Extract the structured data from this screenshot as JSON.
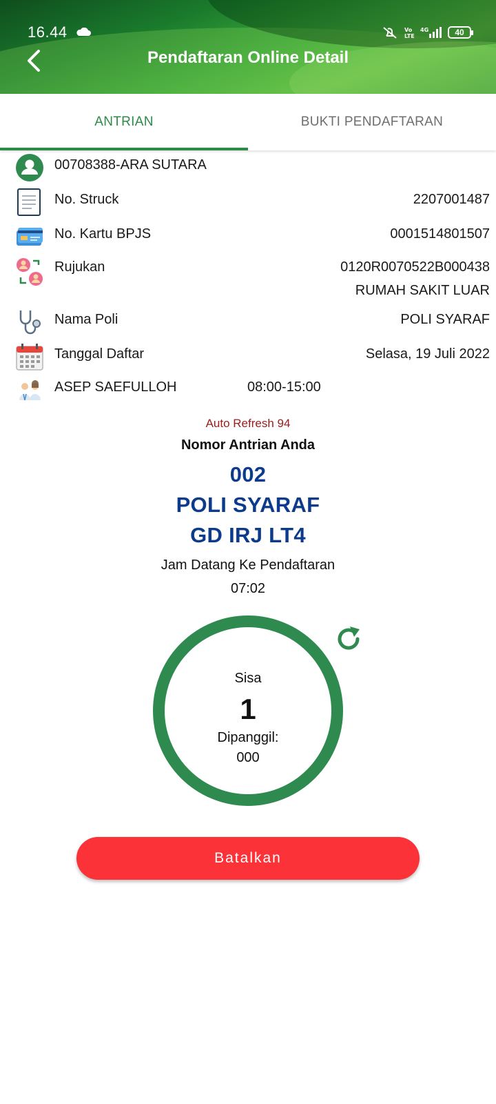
{
  "status_bar": {
    "time": "16.44",
    "battery": "40",
    "icons": [
      "cloud-icon",
      "mute-icon",
      "volte-icon",
      "4g-signal-icon",
      "battery-icon"
    ]
  },
  "app_bar": {
    "title": "Pendaftaran Online Detail",
    "back_icon": "chevron-left-icon"
  },
  "tabs": [
    {
      "label": "ANTRIAN",
      "active": true
    },
    {
      "label": "BUKTI PENDAFTARAN",
      "active": false
    }
  ],
  "details": {
    "patient": {
      "label": "00708388-ARA SUTARA",
      "icon": "user-icon"
    },
    "struck": {
      "label": "No. Struck",
      "value": "2207001487",
      "icon": "receipt-icon"
    },
    "bpjs": {
      "label": "No. Kartu BPJS",
      "value": "0001514801507",
      "icon": "card-icon"
    },
    "rujukan": {
      "label": "Rujukan",
      "value": "0120R0070522B000438",
      "value2": "RUMAH SAKIT LUAR",
      "icon": "referral-icon"
    },
    "poli": {
      "label": "Nama Poli",
      "value": "POLI SYARAF",
      "icon": "stethoscope-icon"
    },
    "tanggal": {
      "label": "Tanggal Daftar",
      "value": "Selasa, 19 Juli 2022",
      "icon": "calendar-icon"
    },
    "dokter": {
      "label": "ASEP SAEFULLOH",
      "value": "08:00-15:00",
      "icon": "doctor-icon"
    }
  },
  "queue": {
    "auto_refresh": "Auto Refresh 94",
    "label": "Nomor Antrian Anda",
    "number": "002",
    "poli": "POLI SYARAF",
    "gedung": "GD IRJ LT4",
    "jam_label": "Jam Datang Ke Pendaftaran",
    "jam_value": "07:02"
  },
  "counter": {
    "sisa_label": "Sisa",
    "sisa_value": "1",
    "dipanggil_label": "Dipanggil:",
    "dipanggil_value": "000",
    "refresh_icon": "refresh-icon"
  },
  "actions": {
    "cancel_label": "Batalkan"
  },
  "colors": {
    "primary_green": "#2e8a4f",
    "queue_blue": "#0d3b8c",
    "auto_refresh_red": "#9e1b1b",
    "cancel_red": "#fb3238"
  }
}
